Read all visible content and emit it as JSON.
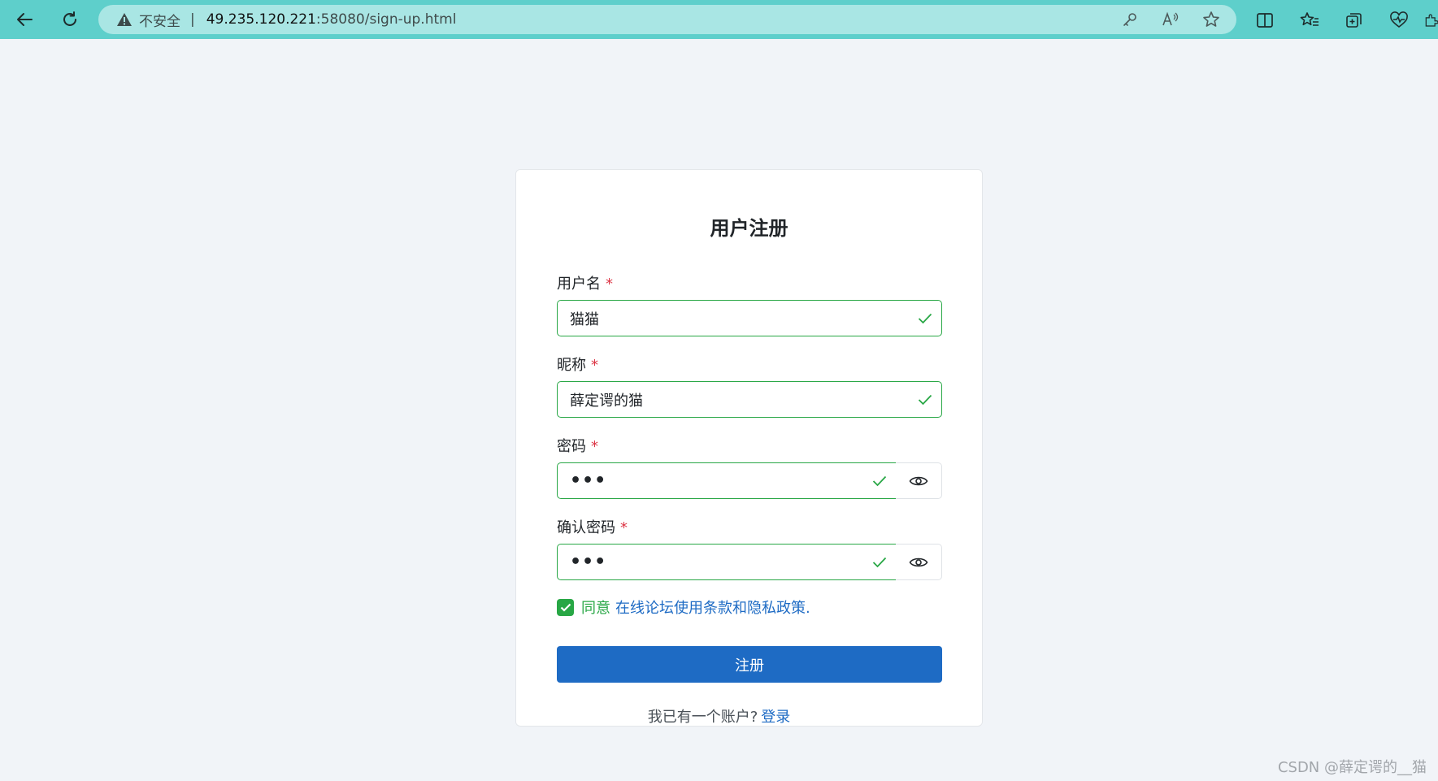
{
  "browser": {
    "insecure_label": "不安全",
    "separator": "|",
    "url_host": "49.235.120.221",
    "url_path": ":58080/sign-up.html"
  },
  "form": {
    "title": "用户注册",
    "required_mark": "*",
    "username": {
      "label": "用户名",
      "value": "猫猫"
    },
    "nickname": {
      "label": "昵称",
      "value": "薛定谔的猫"
    },
    "password": {
      "label": "密码",
      "value": "•••"
    },
    "confirm_password": {
      "label": "确认密码",
      "value": "•••"
    },
    "agree": {
      "prefix": "同意",
      "terms_link": "在线论坛使用条款和隐私政策."
    },
    "submit_label": "注册"
  },
  "footer": {
    "text": "我已有一个账户?",
    "login_link": "登录"
  },
  "watermark": "CSDN @薛定谔的__猫",
  "colors": {
    "chrome": "#5ecfcb",
    "address_bar": "#a9e6e4",
    "valid_green": "#28a745",
    "primary_blue": "#1e6bc4",
    "required_red": "#dc3545"
  },
  "icons": [
    "back-arrow-icon",
    "refresh-icon",
    "warning-icon",
    "key-icon",
    "read-aloud-icon",
    "star-icon",
    "split-screen-icon",
    "favorites-icon",
    "collections-icon",
    "health-icon",
    "check-icon",
    "eye-icon"
  ]
}
